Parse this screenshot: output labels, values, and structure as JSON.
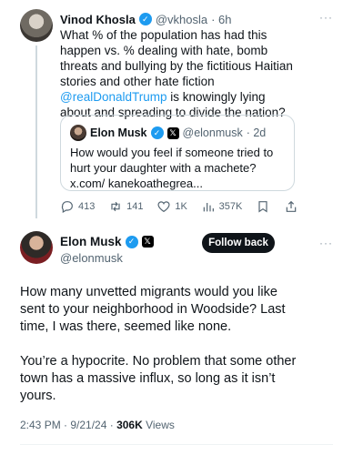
{
  "parent": {
    "name": "Vinod Khosla",
    "handle": "@vkhosla",
    "time": "· 6h",
    "more": "···",
    "text_before": "What % of the population has had this happen vs. % dealing with hate, bomb threats and bullying by the fictitious Haitian stories and other hate fiction ",
    "mention": "@realDonaldTrump",
    "text_after": " is knowingly lying about and spreading to divide the nation?",
    "quote": {
      "name": "Elon Musk",
      "handle": "@elonmusk",
      "time": "· 2d",
      "text": "How would you feel if someone tried to hurt your daughter with a machete? x.com/ kanekoathegrea..."
    },
    "actions": {
      "replies": "413",
      "reposts": "141",
      "likes": "1K",
      "views": "357K"
    }
  },
  "main": {
    "name": "Elon Musk",
    "handle": "@elonmusk",
    "follow_label": "Follow back",
    "more": "···",
    "paragraph1": "How many unvetted migrants would you like sent to your neighborhood in Woodside? Last time, I was there, seemed like none.",
    "paragraph2": "You’re a hypocrite. No problem that some other town has a massive influx, so long as it isn’t yours.",
    "timestamp": "2:43 PM · 9/21/24 · ",
    "views_count": "306K",
    "views_label": " Views"
  },
  "colors": {
    "accent": "#1d9bf0",
    "text": "#0f1419",
    "muted": "#536471",
    "border": "#cfd9de"
  }
}
